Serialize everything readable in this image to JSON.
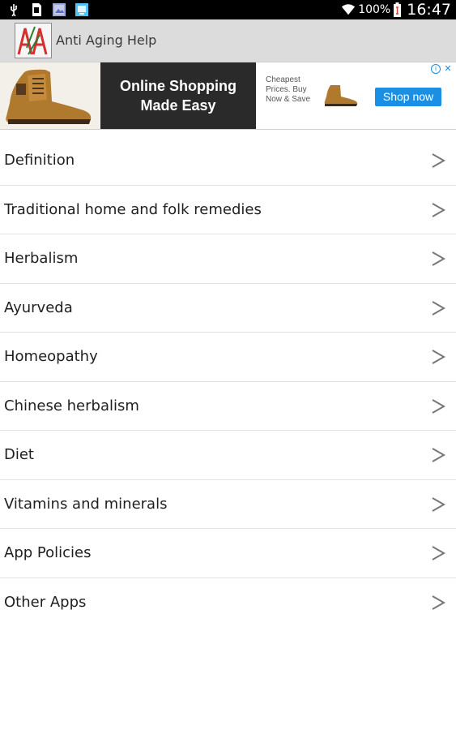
{
  "status_bar": {
    "icons": [
      "usb-icon",
      "sd-card-icon",
      "gallery-icon",
      "screenshot-icon",
      "wifi-icon",
      "battery-icon"
    ],
    "battery": "100%",
    "time": "16:47"
  },
  "app": {
    "title": "Anti Aging Help",
    "logo_text": "AA"
  },
  "ad": {
    "headline": "Online Shopping Made Easy",
    "body": "Cheapest Prices. Buy Now & Save",
    "cta": "Shop now",
    "colors": {
      "cta": "#1a8fe3",
      "panel": "#2a2a2a"
    }
  },
  "menu": {
    "items": [
      {
        "label": "Definition"
      },
      {
        "label": "Traditional home and folk remedies"
      },
      {
        "label": "Herbalism"
      },
      {
        "label": "Ayurveda"
      },
      {
        "label": "Homeopathy"
      },
      {
        "label": "Chinese herbalism"
      },
      {
        "label": "Diet"
      },
      {
        "label": "Vitamins and minerals"
      },
      {
        "label": "App Policies"
      },
      {
        "label": "Other Apps"
      }
    ],
    "chevron_symbol": ">"
  }
}
